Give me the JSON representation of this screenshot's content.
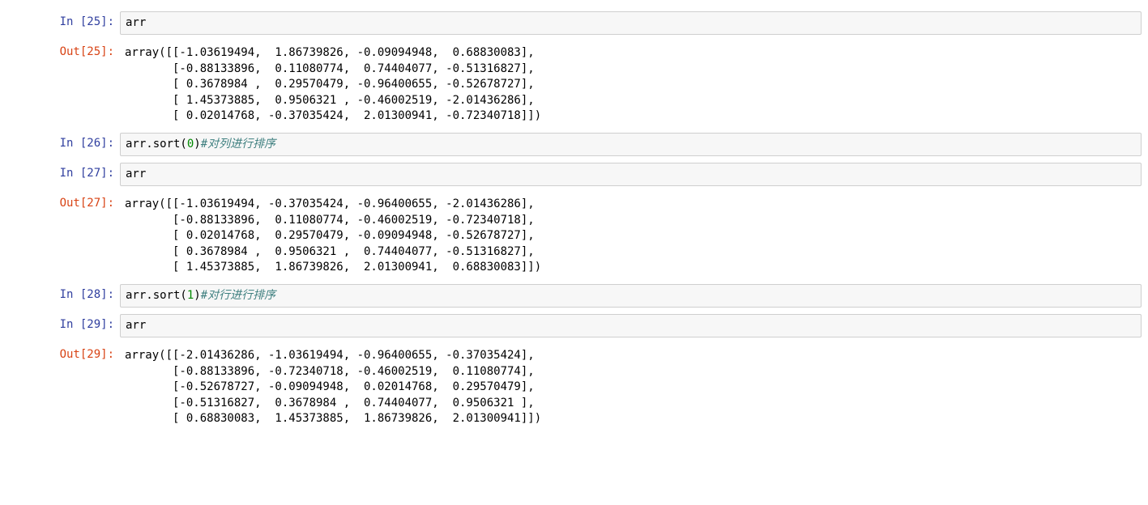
{
  "cells": {
    "c25": {
      "in_prompt": "In  [25]:",
      "out_prompt": "Out[25]:",
      "code_var": "arr",
      "output": "array([[-1.03619494,  1.86739826, -0.09094948,  0.68830083],\n       [-0.88133896,  0.11080774,  0.74404077, -0.51316827],\n       [ 0.3678984 ,  0.29570479, -0.96400655, -0.52678727],\n       [ 1.45373885,  0.9506321 , -0.46002519, -2.01436286],\n       [ 0.02014768, -0.37035424,  2.01300941, -0.72340718]])"
    },
    "c26": {
      "in_prompt": "In  [26]:",
      "code_prefix": "arr.sort(",
      "code_arg": "0",
      "code_suffix": ")",
      "code_comment": "#对列进行排序"
    },
    "c27": {
      "in_prompt": "In  [27]:",
      "out_prompt": "Out[27]:",
      "code_var": "arr",
      "output": "array([[-1.03619494, -0.37035424, -0.96400655, -2.01436286],\n       [-0.88133896,  0.11080774, -0.46002519, -0.72340718],\n       [ 0.02014768,  0.29570479, -0.09094948, -0.52678727],\n       [ 0.3678984 ,  0.9506321 ,  0.74404077, -0.51316827],\n       [ 1.45373885,  1.86739826,  2.01300941,  0.68830083]])"
    },
    "c28": {
      "in_prompt": "In  [28]:",
      "code_prefix": "arr.sort(",
      "code_arg": "1",
      "code_suffix": ")",
      "code_comment": "#对行进行排序"
    },
    "c29": {
      "in_prompt": "In  [29]:",
      "out_prompt": "Out[29]:",
      "code_var": "arr",
      "output": "array([[-2.01436286, -1.03619494, -0.96400655, -0.37035424],\n       [-0.88133896, -0.72340718, -0.46002519,  0.11080774],\n       [-0.52678727, -0.09094948,  0.02014768,  0.29570479],\n       [-0.51316827,  0.3678984 ,  0.74404077,  0.9506321 ],\n       [ 0.68830083,  1.45373885,  1.86739826,  2.01300941]])"
    }
  }
}
